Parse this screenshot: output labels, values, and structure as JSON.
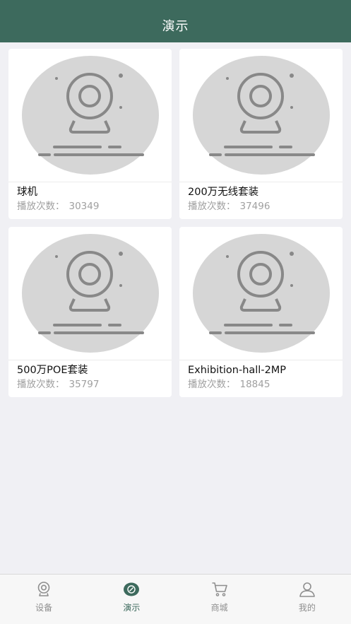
{
  "header": {
    "title": "演示"
  },
  "plays_label": "播放次数：",
  "devices": [
    {
      "title": "球机",
      "plays": "30349"
    },
    {
      "title": "200万无线套装",
      "plays": "37496"
    },
    {
      "title": "500万POE套装",
      "plays": "35797"
    },
    {
      "title": "Exhibition-hall-2MP",
      "plays": "18845"
    }
  ],
  "tabbar": {
    "active_index": 1,
    "tabs": [
      {
        "label": "设备",
        "icon": "camera-icon"
      },
      {
        "label": "演示",
        "icon": "demo-icon"
      },
      {
        "label": "商城",
        "icon": "cart-icon"
      },
      {
        "label": "我的",
        "icon": "user-icon"
      }
    ]
  },
  "colors": {
    "header_bg": "#3d6a5d",
    "accent": "#3d6a5d",
    "page_bg": "#f0f0f4"
  }
}
